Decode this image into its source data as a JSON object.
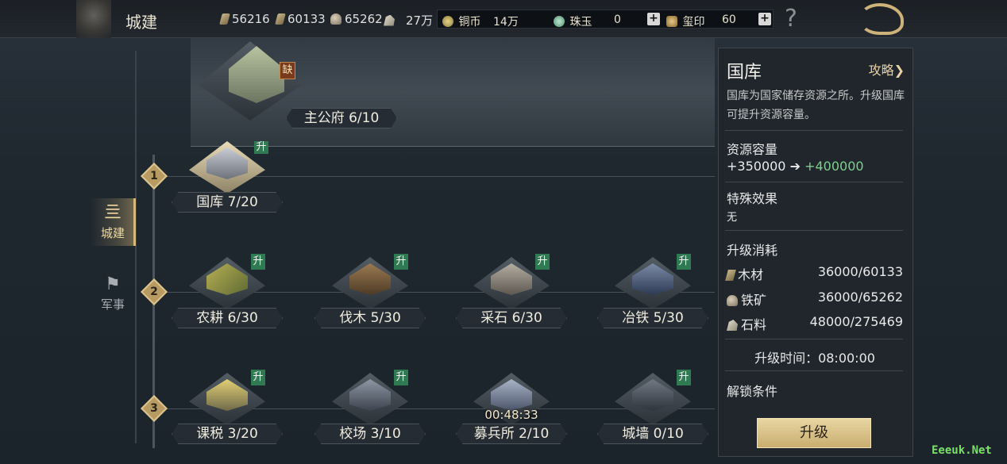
{
  "header": {
    "title": "城建"
  },
  "resources": [
    {
      "name": "wood-icon",
      "value": "56216"
    },
    {
      "name": "iron-icon",
      "value": "60133"
    },
    {
      "name": "stone-icon",
      "value": "65262"
    },
    {
      "name": "stone2-icon",
      "value": "27万"
    }
  ],
  "currencies": {
    "copper": {
      "label": "铜币",
      "value": "14万"
    },
    "jade": {
      "label": "珠玉",
      "value": "0"
    },
    "seal": {
      "label": "玺印",
      "value": "60"
    },
    "plus": "+"
  },
  "help": "?",
  "tabs": [
    {
      "label": "城建",
      "icon": "city-icon",
      "active": true
    },
    {
      "label": "军事",
      "icon": "flag-icon",
      "active": false
    }
  ],
  "main_hall": {
    "label": "主公府 6/10",
    "badge": "缺"
  },
  "tiers": [
    "1",
    "2",
    "3"
  ],
  "buildings": {
    "treasury": {
      "label": "国库 7/20",
      "up": "升"
    },
    "farm": {
      "label": "农耕 6/30",
      "up": "升"
    },
    "lumber": {
      "label": "伐木 5/30",
      "up": "升"
    },
    "quarry": {
      "label": "采石 6/30",
      "up": "升"
    },
    "smelter": {
      "label": "冶铁 5/30",
      "up": "升"
    },
    "tax": {
      "label": "课税 3/20",
      "up": "升"
    },
    "drill": {
      "label": "校场 3/10",
      "up": "升"
    },
    "recruit": {
      "label": "募兵所 2/10",
      "timer": "00:48:33"
    },
    "wall": {
      "label": "城墙 0/10",
      "up": "升"
    }
  },
  "panel": {
    "title": "国库",
    "guide": "攻略❯",
    "description": "国库为国家储存资源之所。升级国库可提升资源容量。",
    "capacity_title": "资源容量",
    "capacity_current": "+350000",
    "capacity_arrow": "➔",
    "capacity_next": "+400000",
    "effect_title": "特殊效果",
    "effect_value": "无",
    "cost_title": "升级消耗",
    "costs": [
      {
        "label": "木材",
        "amount": "36000/60133"
      },
      {
        "label": "铁矿",
        "amount": "36000/65262"
      },
      {
        "label": "石料",
        "amount": "48000/275469"
      }
    ],
    "time": "升级时间：08:00:00",
    "unlock_title": "解锁条件",
    "upgrade_button": "升级"
  },
  "watermark": "Eeeuk.Net",
  "colors": {
    "accent_gold": "#d8b878",
    "upgrade_green": "#2f7a52",
    "capacity_green": "#7fcf8f"
  }
}
